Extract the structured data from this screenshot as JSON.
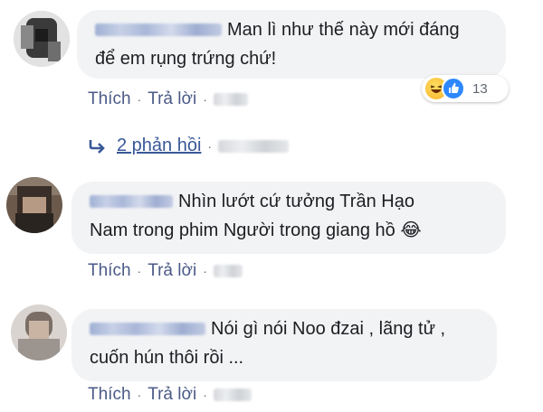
{
  "comments": [
    {
      "text_line1": "Man lì như thế này mới đáng",
      "text_line2": "để em rụng trứng chứ!",
      "like_label": "Thích",
      "reply_label": "Trả lời",
      "reactions": {
        "icons": [
          "haha-emoji",
          "like-thumb-icon"
        ],
        "count": "13"
      }
    },
    {
      "text_line1": "Nhìn lướt cứ tưởng Trần Hạo",
      "text_line2": "Nam trong phim Người trong giang hồ 😂",
      "like_label": "Thích",
      "reply_label": "Trả lời"
    },
    {
      "text_line1": "Nói gì nói Noo đzai , lãng tử ,",
      "text_line2": "cuốn hún thôi rồi ...",
      "like_label": "Thích",
      "reply_label": "Trả lời"
    }
  ],
  "replies_link": {
    "label": "2 phản hồi",
    "icon": "reply-arrow-icon"
  },
  "separator": "·",
  "colors": {
    "bubble": "#f2f3f5",
    "link": "#385898",
    "action": "#4b5a87"
  }
}
